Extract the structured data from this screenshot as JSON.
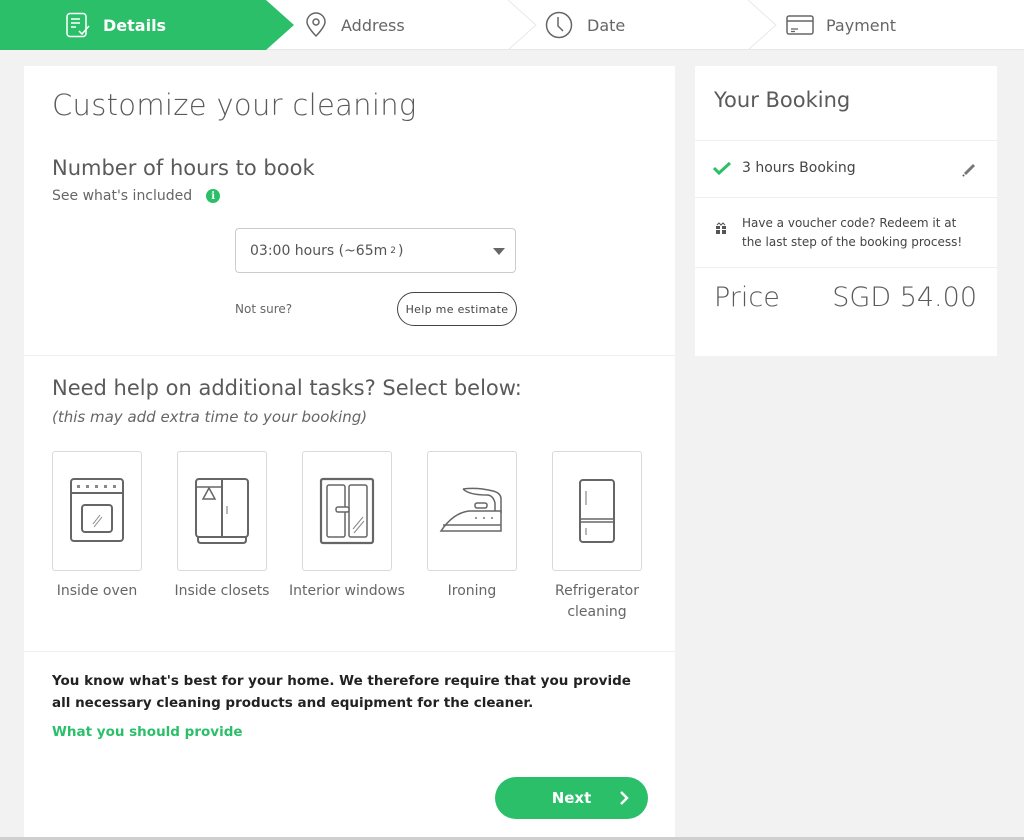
{
  "colors": {
    "accent": "#2bbf6a",
    "text": "#5a5a5a",
    "background": "#f2f2f2"
  },
  "stepper": {
    "steps": [
      {
        "label": "Details",
        "icon": "checklist-icon",
        "active": true
      },
      {
        "label": "Address",
        "icon": "map-pin-icon",
        "active": false
      },
      {
        "label": "Date",
        "icon": "clock-icon",
        "active": false
      },
      {
        "label": "Payment",
        "icon": "credit-card-icon",
        "active": false
      }
    ]
  },
  "main": {
    "title": "Customize your cleaning",
    "hours": {
      "title": "Number of hours to book",
      "included_link": "See what's included",
      "info_icon": "i",
      "select_value": "03:00 hours (~65m",
      "select_sup": "2",
      "select_close": ")",
      "not_sure": "Not sure?",
      "estimate_button": "Help me estimate"
    },
    "tasks": {
      "title": "Need help on additional tasks? Select below:",
      "subtitle": "(this may add extra time to your booking)",
      "items": [
        {
          "label": "Inside oven",
          "icon": "oven-icon"
        },
        {
          "label": "Inside closets",
          "icon": "closet-icon"
        },
        {
          "label": "Interior windows",
          "icon": "window-icon"
        },
        {
          "label": "Ironing",
          "icon": "iron-icon"
        },
        {
          "label": "Refrigerator cleaning",
          "icon": "refrigerator-icon"
        }
      ]
    },
    "notice": "You know what's best for your home. We therefore require that you provide all necessary cleaning products and equipment for the cleaner.",
    "provide_link": "What you should provide",
    "next_button": "Next"
  },
  "booking": {
    "title": "Your Booking",
    "hours_line": "3 hours Booking",
    "voucher_text": "Have a voucher code? Redeem it at the last step of the booking process!",
    "price_label": "Price",
    "price_value": "SGD 54.00"
  }
}
